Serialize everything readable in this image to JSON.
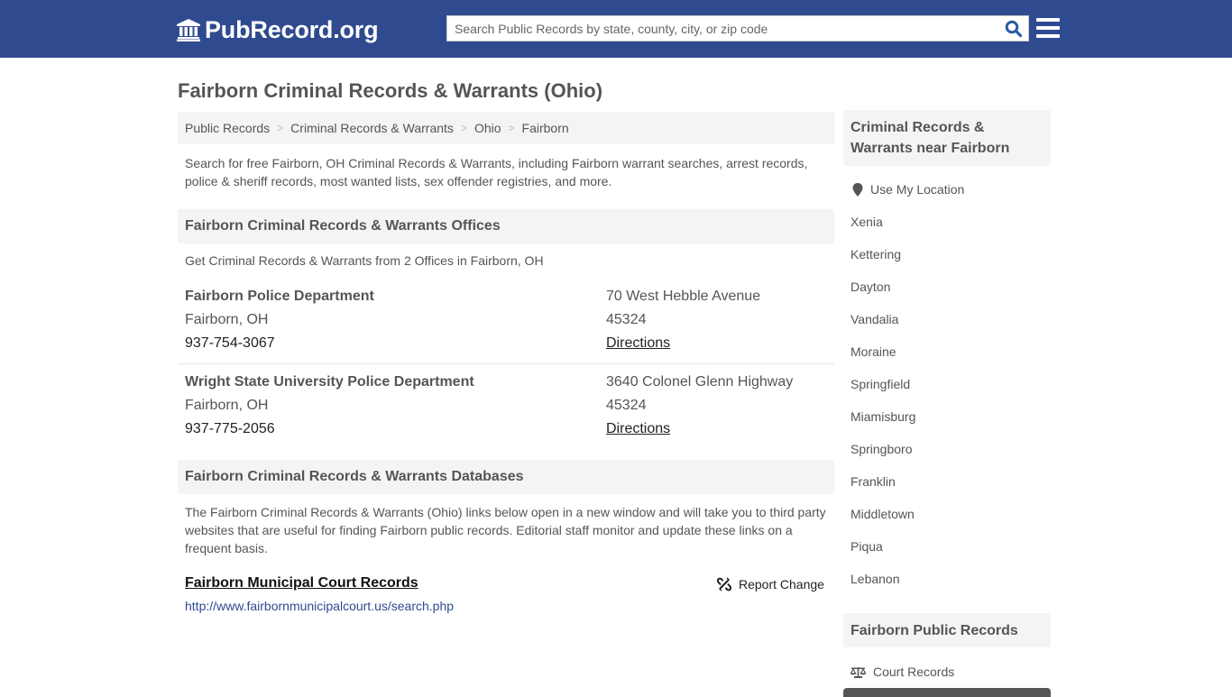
{
  "header": {
    "brand": "PubRecord.org",
    "search_placeholder": "Search Public Records by state, county, city, or zip code",
    "search_value": "",
    "colors": {
      "topbar": "#2f4a8f",
      "search_icon": "#2a5d9f"
    }
  },
  "page": {
    "title": "Fairborn Criminal Records & Warrants (Ohio)",
    "breadcrumb": [
      "Public Records",
      "Criminal Records & Warrants",
      "Ohio",
      "Fairborn"
    ],
    "intro": "Search for free Fairborn, OH Criminal Records & Warrants, including Fairborn warrant searches, arrest records, police & sheriff records, most wanted lists, sex offender registries, and more."
  },
  "offices": {
    "heading": "Fairborn Criminal Records & Warrants Offices",
    "subtitle": "Get Criminal Records & Warrants from 2 Offices in Fairborn, OH",
    "items": [
      {
        "name": "Fairborn Police Department",
        "city": "Fairborn, OH",
        "phone": "937-754-3067",
        "address": "70 West Hebble Avenue",
        "zip": "45324",
        "directions": "Directions"
      },
      {
        "name": "Wright State University Police Department",
        "city": "Fairborn, OH",
        "phone": "937-775-2056",
        "address": "3640 Colonel Glenn Highway",
        "zip": "45324",
        "directions": "Directions"
      }
    ]
  },
  "databases": {
    "heading": "Fairborn Criminal Records & Warrants Databases",
    "description": "The Fairborn Criminal Records & Warrants (Ohio) links below open in a new window and will take you to third party websites that are useful for finding Fairborn public records. Editorial staff monitor and update these links on a frequent basis.",
    "items": [
      {
        "title": "Fairborn Municipal Court Records",
        "url": "http://www.fairbornmunicipalcourt.us/search.php",
        "report_label": "Report Change"
      }
    ]
  },
  "sidebar": {
    "nearby_heading": "Criminal Records & Warrants near Fairborn",
    "use_location": "Use My Location",
    "cities": [
      "Xenia",
      "Kettering",
      "Dayton",
      "Vandalia",
      "Moraine",
      "Springfield",
      "Miamisburg",
      "Springboro",
      "Franklin",
      "Middletown",
      "Piqua",
      "Lebanon"
    ],
    "public_heading": "Fairborn Public Records",
    "public_items": [
      {
        "label": "Court Records",
        "icon": "balance-scale-icon"
      }
    ]
  }
}
